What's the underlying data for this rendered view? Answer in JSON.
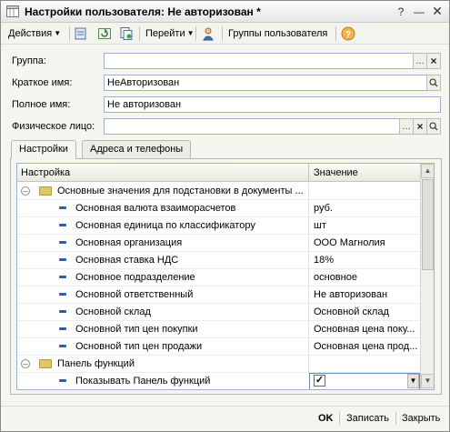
{
  "window": {
    "title": "Настройки пользователя: Не авторизован *"
  },
  "toolbar": {
    "actions_label": "Действия",
    "goto_label": "Перейти",
    "user_groups_label": "Группы пользователя"
  },
  "form": {
    "group_label": "Группа:",
    "group_value": "",
    "short_name_label": "Краткое имя:",
    "short_name_value": "НеАвторизован",
    "full_name_label": "Полное имя:",
    "full_name_value": "Не авторизован",
    "person_label": "Физическое лицо:",
    "person_value": ""
  },
  "tabs": [
    {
      "label": "Настройки",
      "active": true
    },
    {
      "label": "Адреса и телефоны",
      "active": false
    }
  ],
  "grid": {
    "columns": [
      "Настройка",
      "Значение"
    ],
    "rows": [
      {
        "type": "group",
        "name": "Основные значения для подстановки в документы ...",
        "value": ""
      },
      {
        "type": "item",
        "name": "Основная валюта взаиморасчетов",
        "value": "руб."
      },
      {
        "type": "item",
        "name": "Основная единица по классификатору",
        "value": "шт"
      },
      {
        "type": "item",
        "name": "Основная организация",
        "value": "ООО Магнолия"
      },
      {
        "type": "item",
        "name": "Основная ставка НДС",
        "value": "18%"
      },
      {
        "type": "item",
        "name": "Основное подразделение",
        "value": "основное"
      },
      {
        "type": "item",
        "name": "Основной ответственный",
        "value": "Не авторизован"
      },
      {
        "type": "item",
        "name": "Основной склад",
        "value": "Основной склад"
      },
      {
        "type": "item",
        "name": "Основной тип цен покупки",
        "value": "Основная цена поку..."
      },
      {
        "type": "item",
        "name": "Основной тип цен продажи",
        "value": "Основная цена прод..."
      },
      {
        "type": "group",
        "name": "Панель функций",
        "value": ""
      },
      {
        "type": "item",
        "name": "Показывать Панель функций",
        "value": "",
        "checked": true
      }
    ]
  },
  "footer": {
    "ok_label": "OK",
    "save_label": "Записать",
    "close_label": "Закрыть"
  }
}
